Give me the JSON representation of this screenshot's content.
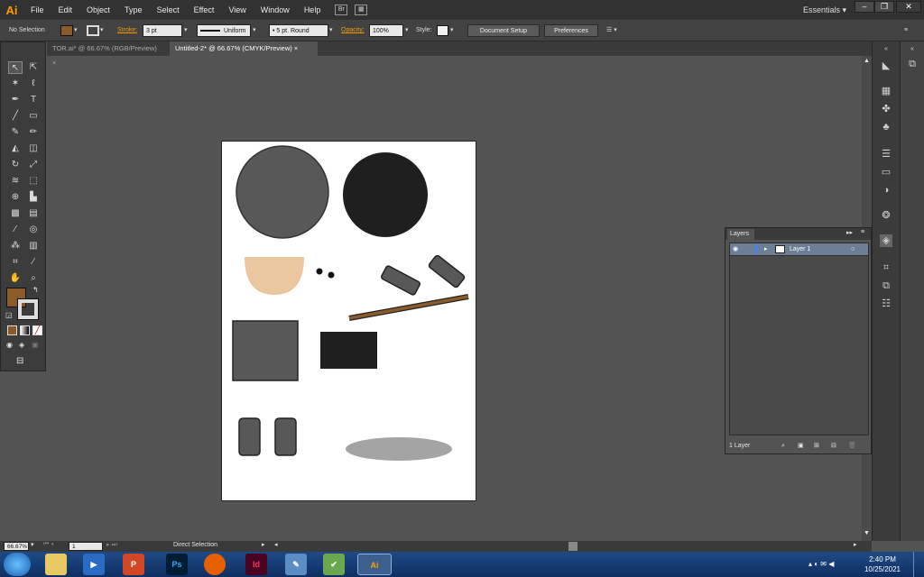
{
  "menubar": {
    "logo": "Ai",
    "items": [
      "File",
      "Edit",
      "Object",
      "Type",
      "Select",
      "Effect",
      "View",
      "Window",
      "Help"
    ],
    "bridge_icon": "Br",
    "workspace": "Essentials"
  },
  "controlbar": {
    "selection": "No Selection",
    "stroke_label": "Stroke:",
    "stroke_value": "3 pt",
    "profile": "Uniform",
    "brush": "5 pt. Round",
    "opacity_label": "Opacity:",
    "opacity_value": "100%",
    "style_label": "Style:",
    "document_setup": "Document Setup",
    "preferences": "Preferences"
  },
  "tabs": [
    {
      "label": "TOR.ai* @ 66.67% (RGB/Preview)",
      "close": "×"
    },
    {
      "label": "Untitled-2* @ 66.67% (CMYK/Preview)",
      "close": "×"
    }
  ],
  "layers_panel": {
    "title": "Layers",
    "layer_name": "Layer 1",
    "layer_count": "1 Layer"
  },
  "statusbar": {
    "zoom": "66.67%",
    "page": "1",
    "tool": "Direct Selection"
  },
  "taskbar": {
    "time": "2:40 PM",
    "date": "10/25/2021",
    "apps": [
      "Ps",
      "Id",
      "Ai"
    ]
  },
  "colors": {
    "fill_swatch": "#8a5a2b",
    "accent": "#ff9a00",
    "layer_selected": "#6d7f95"
  }
}
